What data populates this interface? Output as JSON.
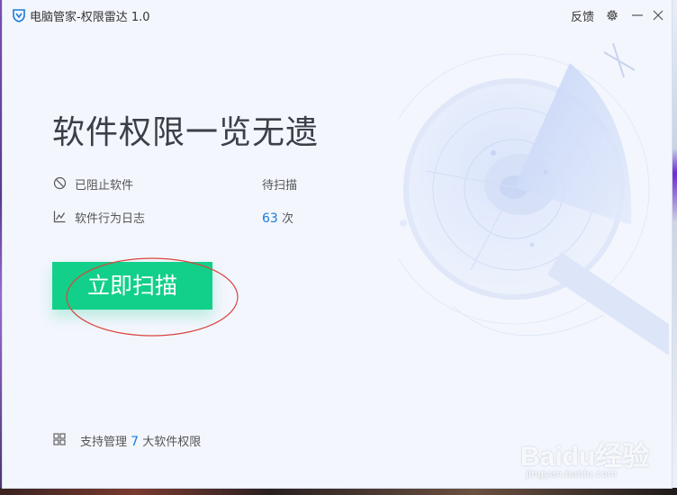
{
  "window": {
    "title": "电脑管家-权限雷达 1.0",
    "feedback_label": "反馈"
  },
  "main": {
    "headline": "软件权限一览无遗",
    "rows": [
      {
        "icon": "block-icon",
        "label": "已阻止软件",
        "value": "待扫描"
      },
      {
        "icon": "chart-icon",
        "label": "软件行为日志",
        "count": "63",
        "unit": "次"
      }
    ],
    "scan_button": "立即扫描"
  },
  "footer": {
    "prefix": "支持管理",
    "count": "7",
    "suffix": "大软件权限"
  },
  "watermark": {
    "text": "Baidu经验",
    "url": "jingyan.baidu.com"
  },
  "colors": {
    "accent_green": "#12d08a",
    "count_blue": "#1a7cd8",
    "background": "#f3f6fd",
    "annotation_red": "#d9453f"
  }
}
